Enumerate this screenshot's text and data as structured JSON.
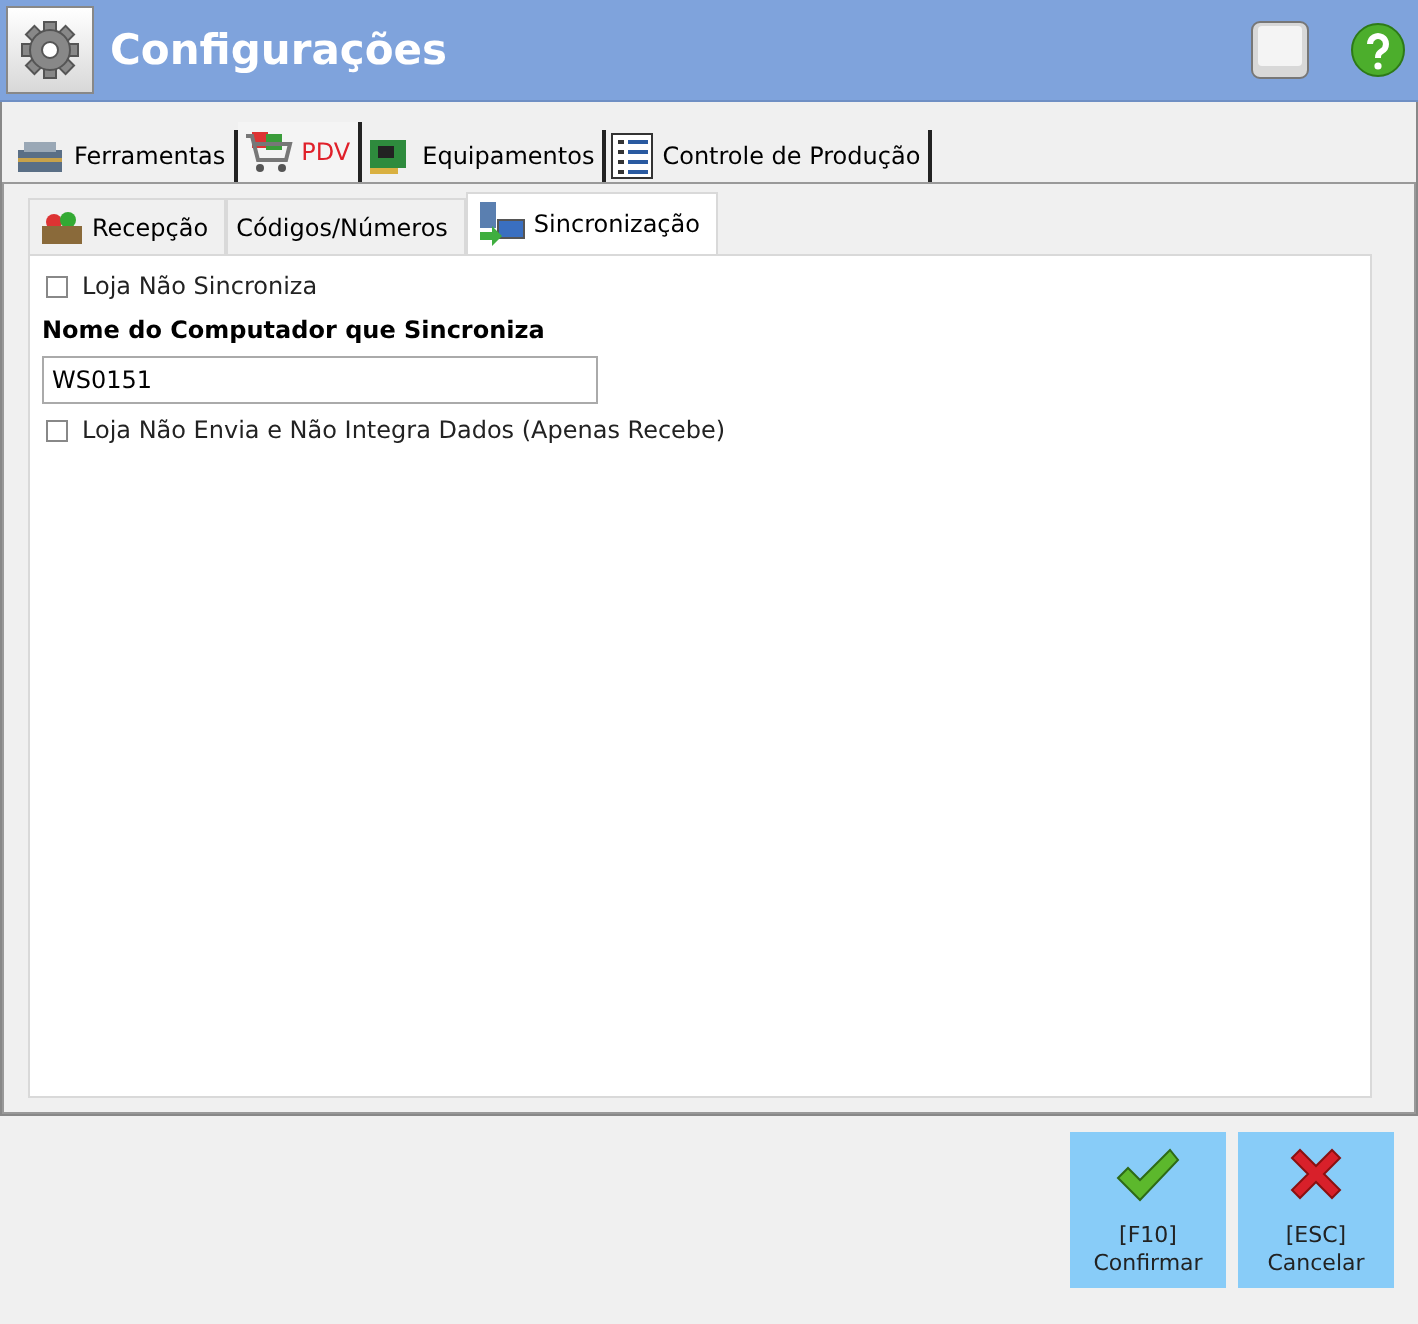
{
  "window": {
    "title": "Configurações"
  },
  "tabs": [
    {
      "label": "Ferramentas",
      "kind": "toolbox",
      "selected": false
    },
    {
      "label": "PDV",
      "kind": "cart",
      "selected": true
    },
    {
      "label": "Equipamentos",
      "kind": "board",
      "selected": false
    },
    {
      "label": "Controle de Produção",
      "kind": "list",
      "selected": false
    }
  ],
  "subtabs": [
    {
      "label": "Recepção",
      "kind": "basket",
      "selected": false
    },
    {
      "label": "Códigos/Números",
      "kind": "plain",
      "selected": false
    },
    {
      "label": "Sincronização",
      "kind": "sync",
      "selected": true
    }
  ],
  "fields": [
    {
      "kind": "checkbox",
      "label": "Loja Não Sincroniza",
      "checked": false
    },
    {
      "kind": "text",
      "label": "Nome do Computador que Sincroniza",
      "value": "WS0151"
    },
    {
      "kind": "checkbox",
      "label": "Loja Não Envia e Não Integra Dados (Apenas Recebe)",
      "checked": false
    }
  ],
  "buttons": [
    {
      "kind": "confirm",
      "key": "[F10]",
      "label": "Confirmar"
    },
    {
      "kind": "cancel",
      "key": "[ESC]",
      "label": "Cancelar"
    }
  ]
}
